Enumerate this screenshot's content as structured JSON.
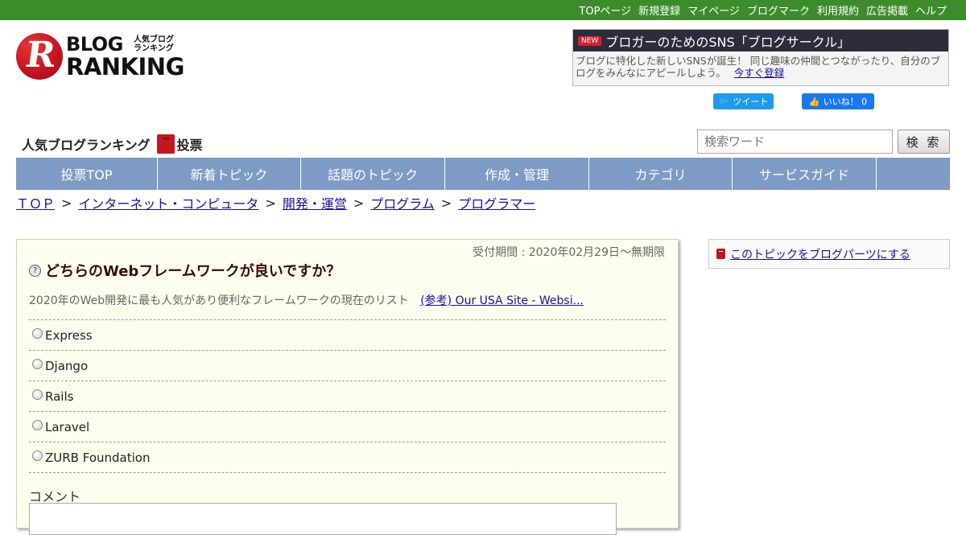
{
  "topbar": {
    "links": [
      "TOPページ",
      "新規登録",
      "マイページ",
      "ブログマーク",
      "利用規約",
      "広告掲載",
      "ヘルプ"
    ],
    "color": "#3d8c2c"
  },
  "logo": {
    "letter": "R",
    "line1": "BLOG",
    "line1_sub": "人気ブログ ランキング",
    "line2": "RANKING"
  },
  "promo": {
    "badge": "NEW",
    "title": "ブロガーのためのSNS「ブログサークル」",
    "body": "ブログに特化した新しいSNSが誕生！ 同じ趣味の仲間とつながったり、自分のブログをみんなにアピールしよう。",
    "link": "今すぐ登録"
  },
  "social": {
    "tweet": "ツイート",
    "like": "いいね！ 0"
  },
  "section": {
    "title": "人気ブログランキング",
    "subtitle": "投票"
  },
  "search": {
    "placeholder": "検索ワード",
    "button": "検 索"
  },
  "nav": {
    "items": [
      "投票TOP",
      "新着トピック",
      "話題のトピック",
      "作成・管理",
      "カテゴリ",
      "サービスガイド",
      ""
    ]
  },
  "breadcrumb": [
    "ＴＯＰ",
    "インターネット・コンピュータ",
    "開発・運営",
    "プログラム",
    "プログラマー"
  ],
  "poll": {
    "period": "受付期間 : 2020年02月29日～無期限",
    "question": "どちらのWebフレームワークが良いですか？",
    "description": "2020年のWeb開発に最も人気があり便利なフレームワークの現在のリスト",
    "reference_link": "(参考) Our USA Site - Websi...",
    "choices": [
      "Express",
      "Django",
      "Rails",
      "Laravel",
      "ZURB Foundation"
    ],
    "comment_label": "コメント"
  },
  "sidebar": {
    "parts_link": "このトピックをブログパーツにする"
  }
}
